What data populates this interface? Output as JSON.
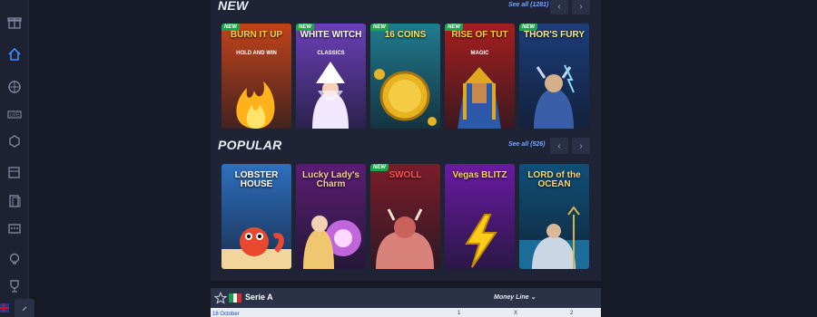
{
  "sidebar": {
    "items": [
      {
        "name": "gift-icon"
      },
      {
        "name": "home-icon",
        "active": true
      },
      {
        "name": "sports-ball-icon"
      },
      {
        "name": "live-icon"
      },
      {
        "name": "casino-icon"
      },
      {
        "name": "slots-icon"
      },
      {
        "name": "cards-icon"
      },
      {
        "name": "lottery-icon"
      },
      {
        "name": "lightbulb-icon"
      },
      {
        "name": "trophy-icon"
      }
    ]
  },
  "sections": {
    "new": {
      "title": "NEW",
      "see_all": "See all (1281)",
      "games": [
        {
          "title": "BURN IT UP",
          "sub": "HOLD AND WIN",
          "badge": "NEW",
          "bg": "#c2431a"
        },
        {
          "title": "WHITE WITCH",
          "sub": "CLASSICS",
          "badge": "NEW",
          "bg": "#6b3fb8"
        },
        {
          "title": "16 COINS",
          "sub": "",
          "badge": "NEW",
          "bg": "#1f7c8f"
        },
        {
          "title": "RISE OF TUT",
          "sub": "MAGIC",
          "badge": "NEW",
          "bg": "#a61e1e"
        },
        {
          "title": "THOR'S FURY",
          "sub": "",
          "badge": "NEW",
          "bg": "#1b3d7a"
        }
      ]
    },
    "popular": {
      "title": "POPULAR",
      "see_all": "See all (526)",
      "games": [
        {
          "title": "LOBSTER HOUSE",
          "sub": "",
          "badge": "",
          "bg": "#2e6fbf"
        },
        {
          "title": "Lucky Lady's Charm",
          "sub": "",
          "badge": "",
          "bg": "#5a1c73"
        },
        {
          "title": "SWOLL",
          "sub": "",
          "badge": "NEW",
          "bg": "#7b1c2a"
        },
        {
          "title": "Vegas BLITZ",
          "sub": "",
          "badge": "",
          "bg": "#6a1aa3"
        },
        {
          "title": "LORD of the OCEAN",
          "sub": "",
          "badge": "",
          "bg": "#0f4f77"
        }
      ]
    }
  },
  "sports": {
    "league": "Serie A",
    "market": "Money Line",
    "date": "18 October",
    "odds_headers": [
      "1",
      "X",
      "2"
    ]
  }
}
